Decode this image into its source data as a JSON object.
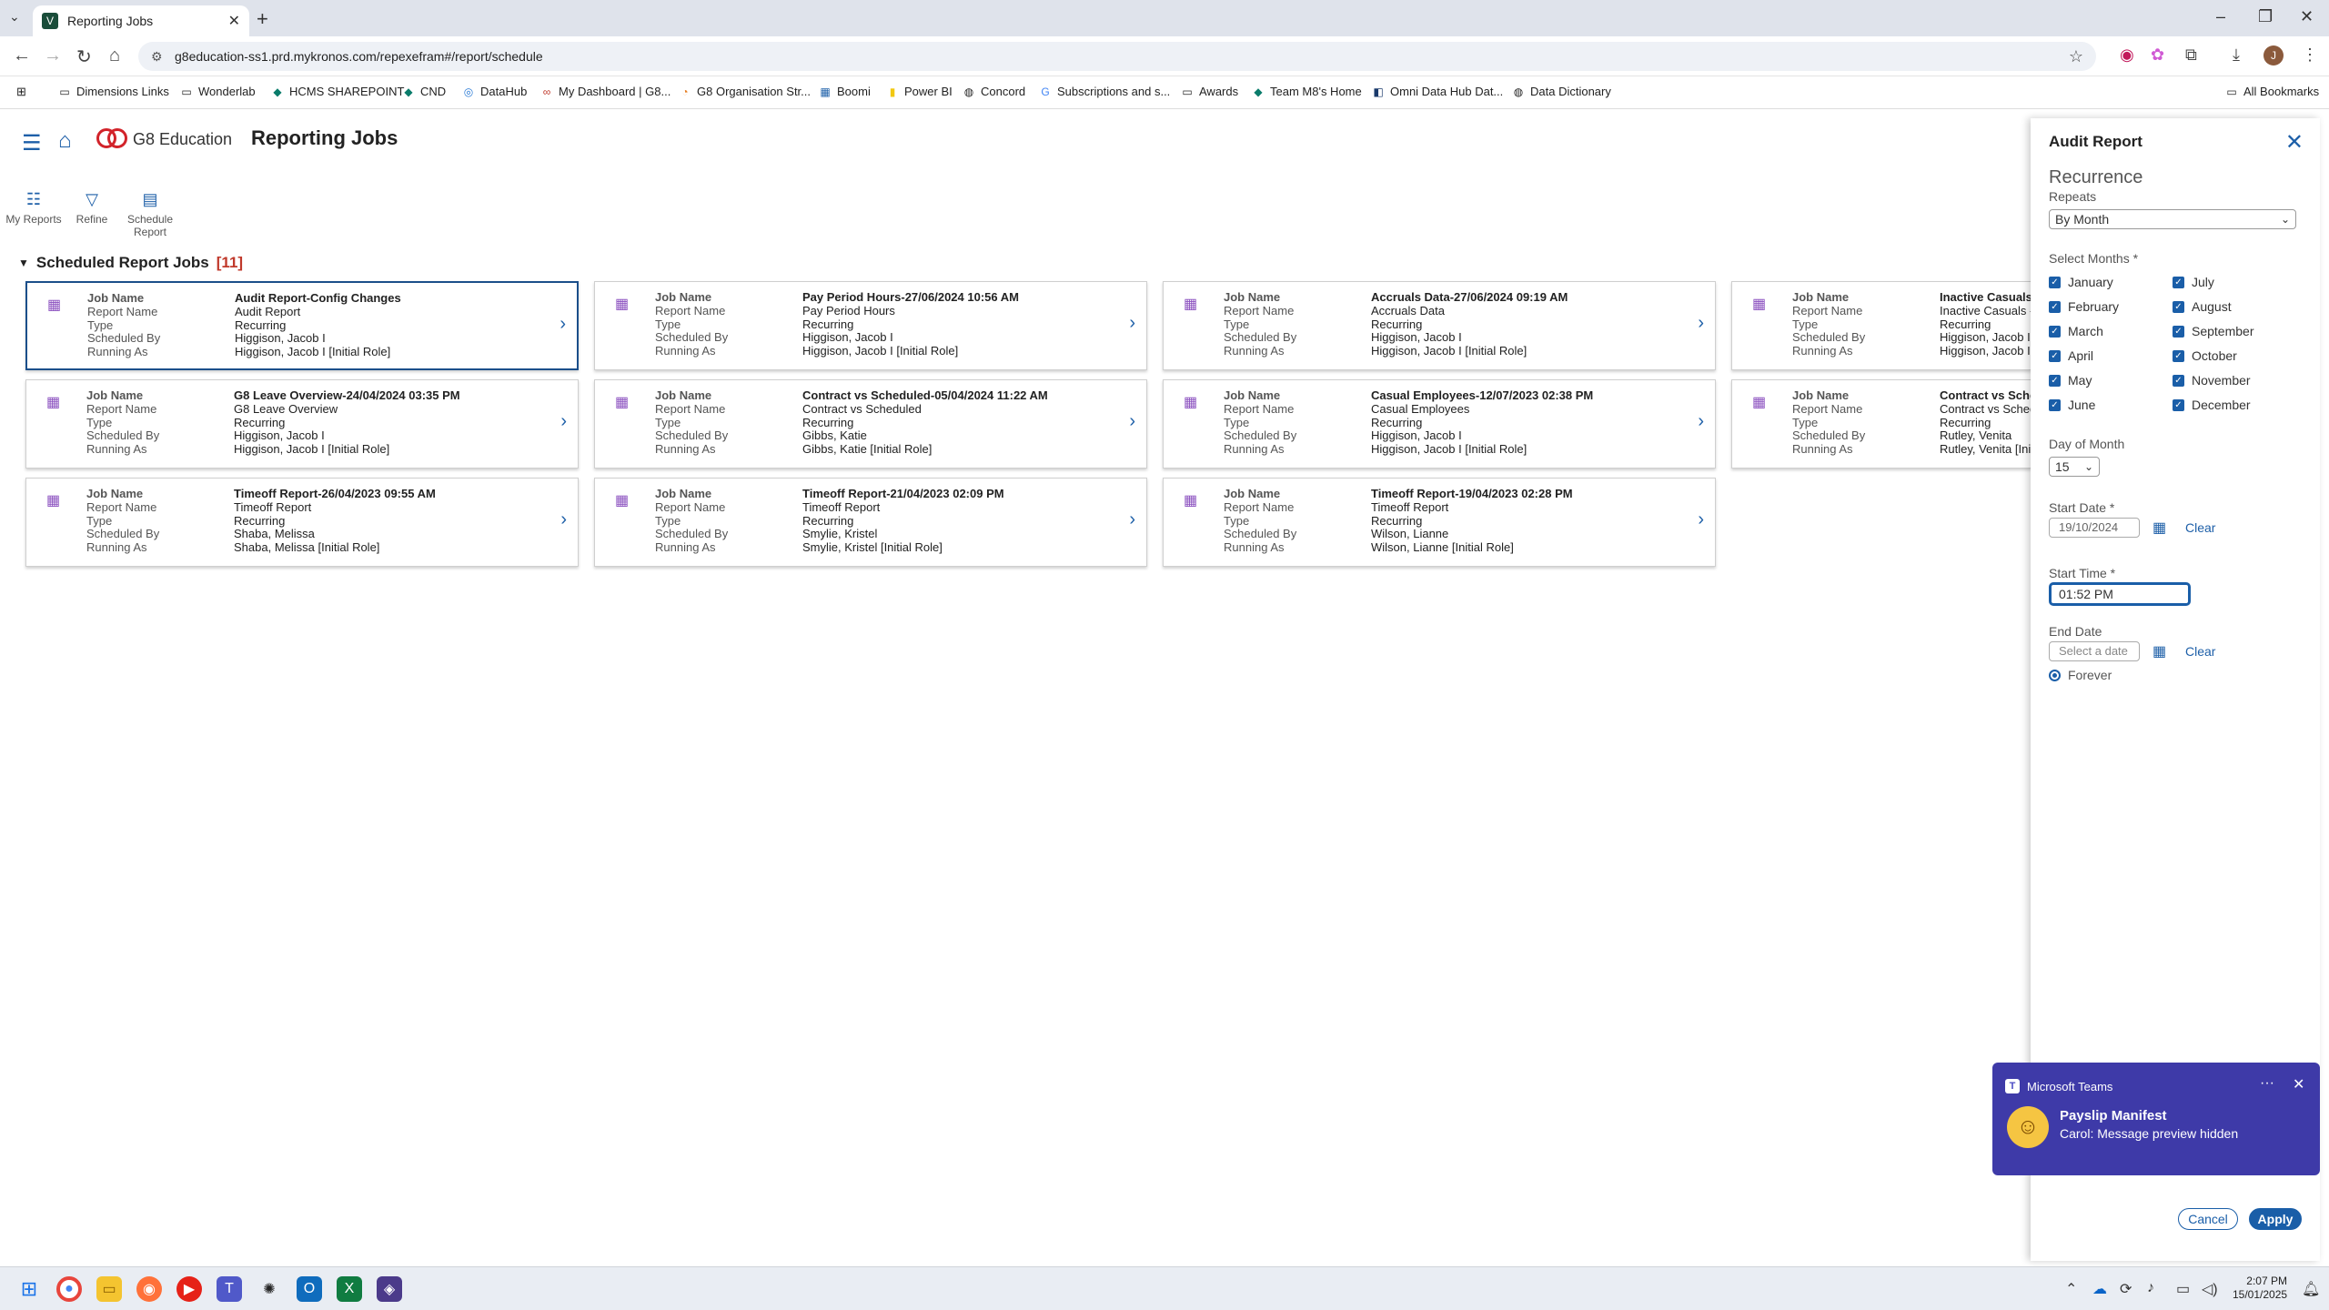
{
  "browser": {
    "tab_title": "Reporting Jobs",
    "url": "g8education-ss1.prd.mykronos.com/repexefram#/report/schedule",
    "bookmarks": [
      "Dimensions Links",
      "Wonderlab",
      "HCMS SHAREPOINT",
      "CND",
      "DataHub",
      "My Dashboard | G8...",
      "G8 Organisation Str...",
      "Boomi",
      "Power BI",
      "Concord",
      "Subscriptions and s...",
      "Awards",
      "Team M8's Home",
      "Omni Data Hub Dat...",
      "Data Dictionary"
    ],
    "all_bookmarks": "All Bookmarks",
    "avatar_initial": "J"
  },
  "app": {
    "brand": "G8 Education",
    "title": "Reporting Jobs",
    "actions": [
      "My Reports",
      "Refine",
      "Schedule Report"
    ],
    "section_title": "Scheduled Report Jobs",
    "section_count": "[11]"
  },
  "labels": [
    "Job Name",
    "Report Name",
    "Type",
    "Scheduled By",
    "Running As"
  ],
  "jobs": [
    {
      "job": "Audit Report-Config Changes",
      "report": "Audit Report",
      "type": "Recurring",
      "by": "Higgison, Jacob I",
      "as": "Higgison, Jacob I [Initial Role]"
    },
    {
      "job": "Pay Period Hours-27/06/2024 10:56 AM",
      "report": "Pay Period Hours",
      "type": "Recurring",
      "by": "Higgison, Jacob I",
      "as": "Higgison, Jacob I [Initial Role]"
    },
    {
      "job": "Accruals Data-27/06/2024 09:19 AM",
      "report": "Accruals Data",
      "type": "Recurring",
      "by": "Higgison, Jacob I",
      "as": "Higgison, Jacob I [Initial Role]"
    },
    {
      "job": "Inactive Casuals - E",
      "report": "Inactive Casuals - E",
      "type": "Recurring",
      "by": "Higgison, Jacob I",
      "as": "Higgison, Jacob I"
    },
    {
      "job": "G8 Leave Overview-24/04/2024 03:35 PM",
      "report": "G8 Leave Overview",
      "type": "Recurring",
      "by": "Higgison, Jacob I",
      "as": "Higgison, Jacob I [Initial Role]"
    },
    {
      "job": "Contract vs Scheduled-05/04/2024 11:22 AM",
      "report": "Contract vs Scheduled",
      "type": "Recurring",
      "by": "Gibbs, Katie",
      "as": "Gibbs, Katie [Initial Role]"
    },
    {
      "job": "Casual Employees-12/07/2023 02:38 PM",
      "report": "Casual Employees",
      "type": "Recurring",
      "by": "Higgison, Jacob I",
      "as": "Higgison, Jacob I [Initial Role]"
    },
    {
      "job": "Contract vs Schedu",
      "report": "Contract vs Schedul",
      "type": "Recurring",
      "by": "Rutley, Venita",
      "as": "Rutley, Venita [Init"
    },
    {
      "job": "Timeoff Report-26/04/2023 09:55 AM",
      "report": "Timeoff Report",
      "type": "Recurring",
      "by": "Shaba, Melissa",
      "as": "Shaba, Melissa [Initial Role]"
    },
    {
      "job": "Timeoff Report-21/04/2023 02:09 PM",
      "report": "Timeoff Report",
      "type": "Recurring",
      "by": "Smylie, Kristel",
      "as": "Smylie, Kristel [Initial Role]"
    },
    {
      "job": "Timeoff Report-19/04/2023 02:28 PM",
      "report": "Timeoff Report",
      "type": "Recurring",
      "by": "Wilson, Lianne",
      "as": "Wilson, Lianne [Initial Role]"
    }
  ],
  "panel": {
    "title": "Audit Report",
    "recurrence": "Recurrence",
    "repeats_label": "Repeats",
    "repeats_value": "By Month",
    "months_label": "Select Months *",
    "months": [
      "January",
      "February",
      "March",
      "April",
      "May",
      "June",
      "July",
      "August",
      "September",
      "October",
      "November",
      "December"
    ],
    "dom_label": "Day of Month",
    "dom_value": "15",
    "start_date_label": "Start Date *",
    "start_date": "19/10/2024",
    "clear": "Clear",
    "start_time_label": "Start Time *",
    "start_time": "01:52 PM",
    "end_date_label": "End Date",
    "end_date_placeholder": "Select a date",
    "forever": "Forever",
    "cancel": "Cancel",
    "apply": "Apply"
  },
  "toast": {
    "app": "Microsoft Teams",
    "title": "Payslip Manifest",
    "message": "Carol: Message preview hidden"
  },
  "taskbar": {
    "time": "2:07 PM",
    "date": "15/01/2025"
  },
  "colors": {
    "accent": "#1a5ea8",
    "brand_red": "#d2232a",
    "teams": "#3e3aa8"
  }
}
